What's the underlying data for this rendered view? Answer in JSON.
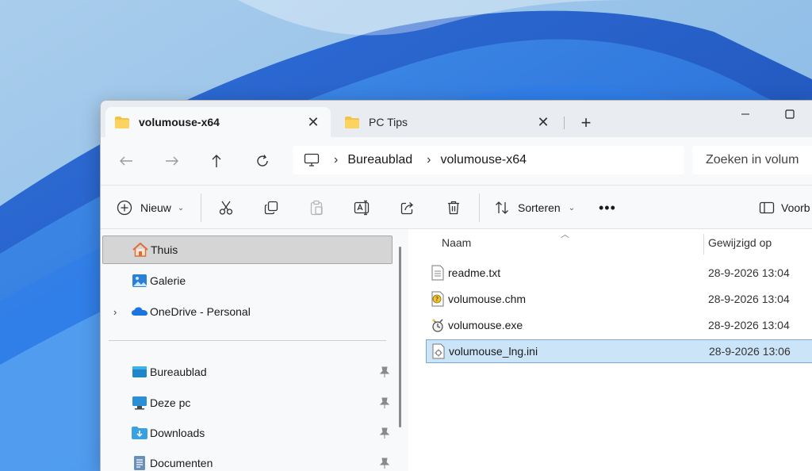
{
  "tabs": [
    {
      "label": "volumouse-x64",
      "active": true
    },
    {
      "label": "PC Tips",
      "active": false
    }
  ],
  "breadcrumb": [
    "Bureaublad",
    "volumouse-x64"
  ],
  "search": {
    "placeholder": "Zoeken in volum"
  },
  "toolbar": {
    "new_label": "Nieuw",
    "sort_label": "Sorteren",
    "preview_label": "Voorb"
  },
  "sidebar": {
    "items": [
      {
        "label": "Thuis",
        "icon": "home-icon",
        "selected": true
      },
      {
        "label": "Galerie",
        "icon": "gallery-icon"
      },
      {
        "label": "OneDrive - Personal",
        "icon": "onedrive-icon",
        "expandable": true
      },
      {
        "label": "Bureaublad",
        "icon": "desktop-icon",
        "pinned": true
      },
      {
        "label": "Deze pc",
        "icon": "pc-icon",
        "pinned": true
      },
      {
        "label": "Downloads",
        "icon": "downloads-icon",
        "pinned": true
      },
      {
        "label": "Documenten",
        "icon": "documents-icon",
        "pinned": true
      }
    ]
  },
  "columns": {
    "name": "Naam",
    "modified": "Gewijzigd op"
  },
  "files": [
    {
      "name": "readme.txt",
      "modified": "28-9-2026 13:04",
      "icon": "text-file-icon"
    },
    {
      "name": "volumouse.chm",
      "modified": "28-9-2026 13:04",
      "icon": "help-file-icon"
    },
    {
      "name": "volumouse.exe",
      "modified": "28-9-2026 13:04",
      "icon": "exe-file-icon"
    },
    {
      "name": "volumouse_lng.ini",
      "modified": "28-9-2026 13:06",
      "icon": "ini-file-icon",
      "selected": true
    }
  ],
  "colors": {
    "accent": "#0067c0",
    "selection": "#cce4f7",
    "folder": "#f6c244"
  }
}
